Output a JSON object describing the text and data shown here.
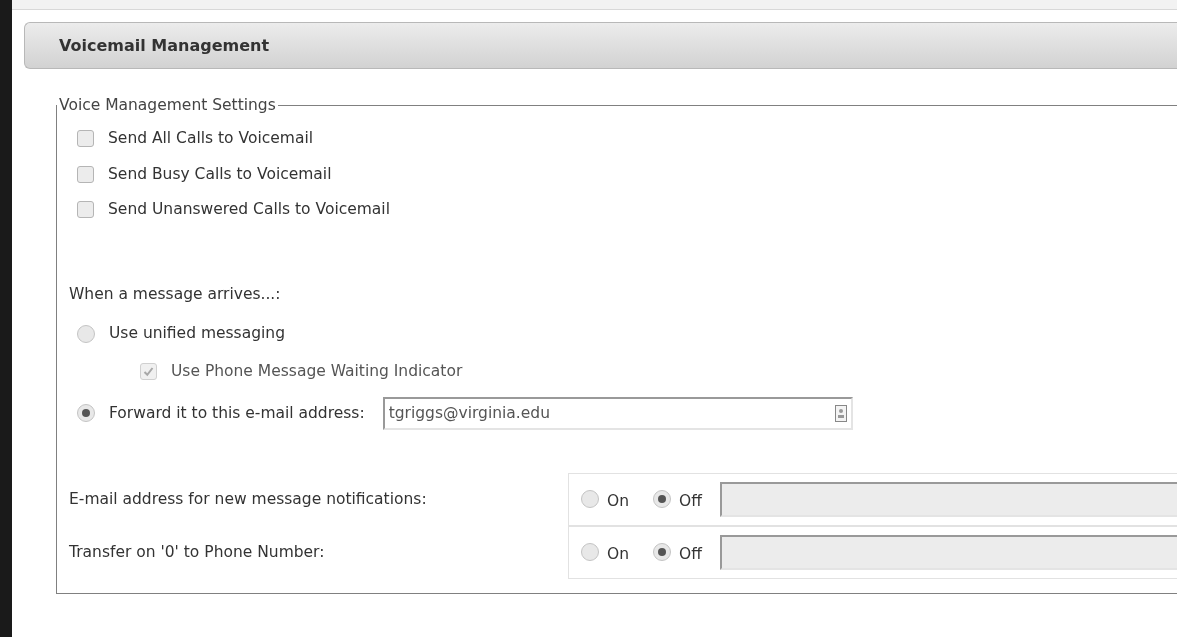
{
  "panel": {
    "title": "Voicemail Management"
  },
  "fieldset": {
    "legend": "Voice Management Settings",
    "checkboxes": [
      {
        "label": "Send All Calls to Voicemail",
        "checked": false
      },
      {
        "label": "Send Busy Calls to Voicemail",
        "checked": false
      },
      {
        "label": "Send Unanswered Calls to Voicemail",
        "checked": false
      }
    ],
    "arrival_label": "When a message arrives...:",
    "arrival_options": [
      {
        "kind": "plain",
        "label": "Use unified messaging",
        "selected": false,
        "sub_option": {
          "label": "Use Phone Message Waiting Indicator",
          "checked": true,
          "disabled": true
        }
      },
      {
        "kind": "email",
        "label": "Forward it to this e-mail address:",
        "selected": true,
        "value": "tgriggs@virginia.edu"
      }
    ],
    "toggle_rows": [
      {
        "label": "E-mail address for new message notifications:",
        "on_label": "On",
        "off_label": "Off",
        "on": false
      },
      {
        "label": "Transfer on '0' to Phone Number:",
        "on_label": "On",
        "off_label": "Off",
        "on": false
      }
    ]
  }
}
